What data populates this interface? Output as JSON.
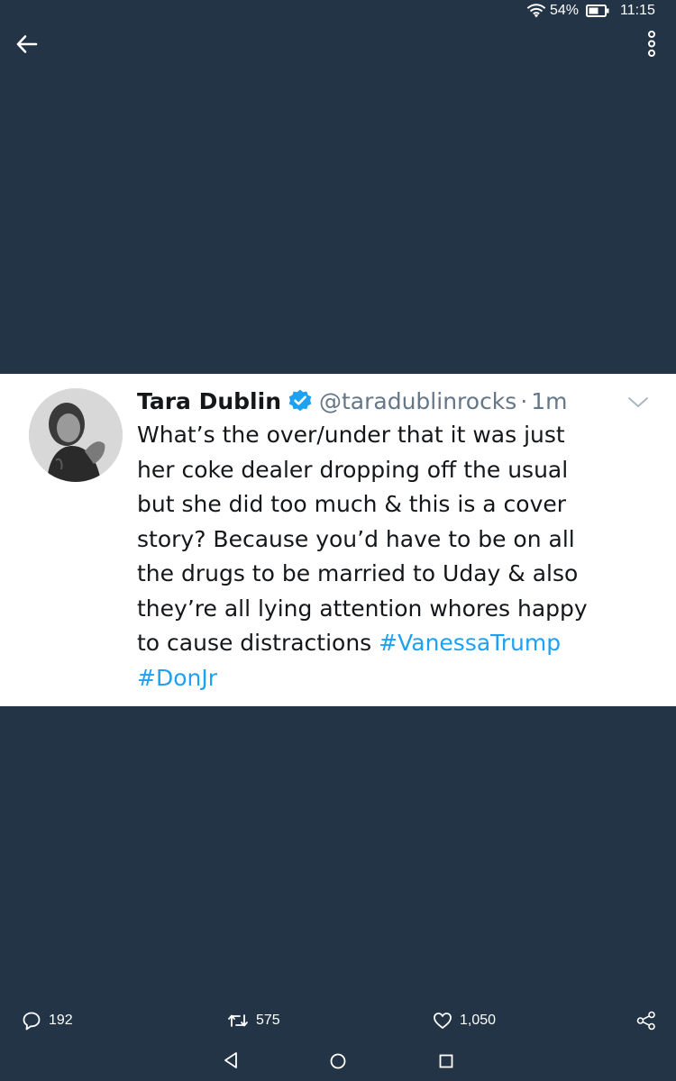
{
  "status_bar": {
    "battery_percent": "54%",
    "time": "11:15",
    "wifi_icon": "wifi-icon",
    "battery_icon": "battery-icon"
  },
  "top_nav": {
    "back_icon": "arrow-left-icon",
    "more_icon": "more-vertical-icon"
  },
  "tweet": {
    "author_name": "Tara Dublin",
    "verified": true,
    "handle": "@taradublinrocks",
    "separator": "·",
    "time": "1m",
    "text_lines": [
      "What’s the over/under that it was just",
      "her coke dealer dropping off the usual",
      "but she did too much & this is a cover",
      "story? Because you’d have to be on all",
      "the drugs to be married to Uday & also",
      "they’re all lying attention whores happy",
      "to cause distractions "
    ],
    "hashtags": [
      "#VanessaTrump",
      "#DonJr"
    ]
  },
  "actions": {
    "replies": "192",
    "retweets": "575",
    "likes": "1,050",
    "share_icon": "share-icon"
  },
  "nav_bar": {
    "back_icon": "triangle-back-icon",
    "home_icon": "circle-home-icon",
    "recents_icon": "square-recents-icon"
  },
  "colors": {
    "background": "#243447",
    "card": "#ffffff",
    "text": "#14171a",
    "secondary_text": "#657786",
    "link": "#1da1f2",
    "verified": "#1da1f2"
  }
}
